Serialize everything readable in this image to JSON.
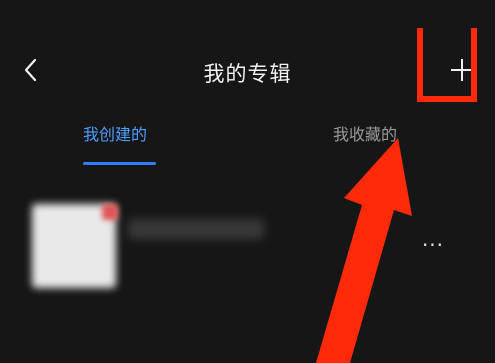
{
  "header": {
    "title": "我的专辑",
    "back_icon": "chevron-left-icon",
    "add_icon": "plus-icon"
  },
  "tabs": [
    {
      "label": "我创建的",
      "active": true
    },
    {
      "label": "我收藏的",
      "active": false
    }
  ],
  "album": {
    "more_label": "···"
  },
  "colors": {
    "background": "#161616",
    "accent": "#4d9eff",
    "annotation": "#ff2a0a"
  }
}
